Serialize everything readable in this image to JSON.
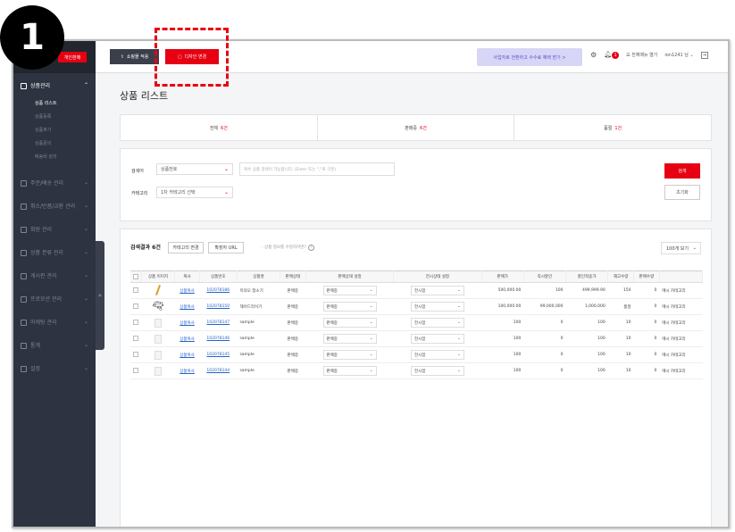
{
  "step_badge": "1",
  "sidebar": {
    "logo_text": "개인판매",
    "menus": [
      {
        "label": "상품관리",
        "active": true,
        "items": [
          "상품 리스트",
          "상품등록",
          "상품후기",
          "상품문의",
          "배송비 관리"
        ]
      },
      {
        "label": "주문/배송 관리"
      },
      {
        "label": "취소/반품/교환 관리"
      },
      {
        "label": "회원 관리"
      },
      {
        "label": "상품 분류 관리"
      },
      {
        "label": "게시판 관리"
      },
      {
        "label": "프로모션 관리"
      },
      {
        "label": "마케팅 관리"
      },
      {
        "label": "통계"
      },
      {
        "label": "설정"
      }
    ],
    "toggle": "«"
  },
  "header": {
    "apply_button": "쇼핑몰 적용",
    "design_button": "디자인 변경",
    "promo": "사업자로 전환하고 수수료 혜택 받기 >",
    "notif_count": "1",
    "menu_all": "전체메뉴 열기",
    "user": "ion1241 님"
  },
  "page_title": "상품 리스트",
  "summary_tabs": [
    {
      "label": "전체",
      "count": "6건"
    },
    {
      "label": "판매중",
      "count": "6건"
    },
    {
      "label": "품절",
      "count": "1건"
    }
  ],
  "search": {
    "keyword_label": "검색어",
    "keyword_select": "상품번호",
    "keyword_placeholder": "복수 상품 검색이 가능합니다. (Enter 또는 \",\"로 구분)",
    "category_label": "카테고리",
    "category_select": "1차 카테고리 선택",
    "search_button": "검색",
    "reset_button": "초기화"
  },
  "results": {
    "title": "검색결과 6건",
    "btn_category": "카테고리 변경",
    "btn_url": "확장자 URL",
    "note": "- 상품 정보를 수정하려면?",
    "per_page": "100개 보기",
    "columns": [
      "상품 이미지",
      "복사",
      "상품번호",
      "상품명",
      "판매상태",
      "판매상태 설정",
      "전시상태 설정",
      "판매가",
      "즉시할인",
      "할인적용가",
      "재고수량",
      "판매수량"
    ],
    "rows": [
      {
        "copy": "상품복사",
        "id": "102078186",
        "name": "미의오 청소기",
        "status": "판매중",
        "sale_set": "판매중",
        "display_set": "전시함",
        "price": "500,000.00",
        "discount": "100",
        "final": "499,999.90",
        "stock": "150",
        "sold": "0",
        "cat": "메시 카테고리"
      },
      {
        "copy": "상품복사",
        "id": "102078150",
        "name": "헤어드라이기",
        "status": "판매중",
        "sale_set": "판매중",
        "display_set": "전시함",
        "price": "100,000.00",
        "discount": "99,000,000",
        "final": "1,000,000",
        "stock": "품절",
        "sold": "0",
        "cat": "메시 카테고리"
      },
      {
        "copy": "상품복사",
        "id": "102078147",
        "name": "sample",
        "status": "판매중",
        "sale_set": "판매중",
        "display_set": "전시함",
        "price": "100",
        "discount": "0",
        "final": "100",
        "stock": "10",
        "sold": "0",
        "cat": "메시 카테고리"
      },
      {
        "copy": "상품복사",
        "id": "102078146",
        "name": "sample",
        "status": "판매중",
        "sale_set": "판매중",
        "display_set": "전시함",
        "price": "100",
        "discount": "0",
        "final": "100",
        "stock": "10",
        "sold": "0",
        "cat": "메시 카테고리"
      },
      {
        "copy": "상품복사",
        "id": "102078145",
        "name": "sample",
        "status": "판매중",
        "sale_set": "판매중",
        "display_set": "전시함",
        "price": "100",
        "discount": "0",
        "final": "100",
        "stock": "10",
        "sold": "0",
        "cat": "메시 카테고리"
      },
      {
        "copy": "상품복사",
        "id": "102078144",
        "name": "sample",
        "status": "판매중",
        "sale_set": "판매중",
        "display_set": "전시함",
        "price": "100",
        "discount": "0",
        "final": "100",
        "stock": "10",
        "sold": "0",
        "cat": "메시 카테고리"
      }
    ]
  },
  "colors": {
    "accent": "#e60012",
    "sidebar_bg": "#2d3340"
  }
}
